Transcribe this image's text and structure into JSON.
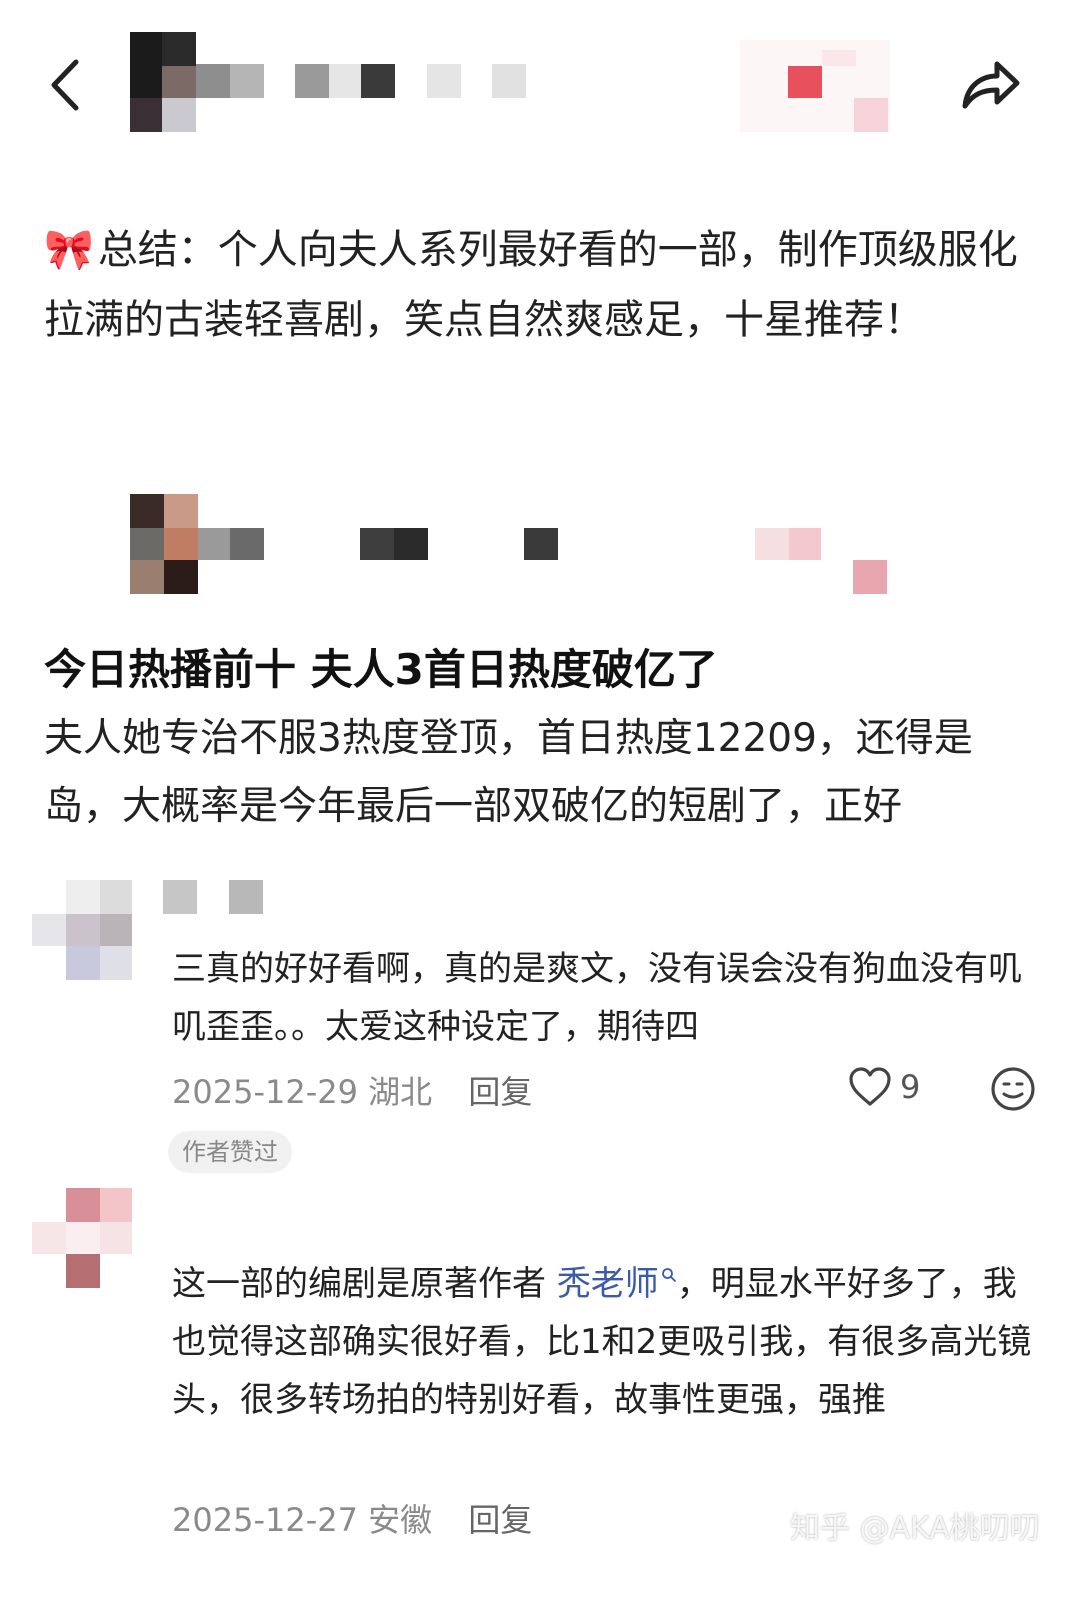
{
  "post": {
    "summary_emoji": "🎀",
    "summary_text": "总结：个人向夫人系列最好看的一部，制作顶级服化拉满的古装轻喜剧，笑点自然爽感足，十星推荐！"
  },
  "quoted_post": {
    "headline": "今日热播前十 夫人3首日热度破亿了",
    "body": "夫人她专治不服3热度登顶，首日热度12209，还得是岛，大概率是今年最后一部双破亿的短剧了，正好"
  },
  "comments": [
    {
      "text": "三真的好好看啊，真的是爽文，没有误会没有狗血没有叽叽歪歪。。太爱这种设定了，期待四",
      "date": "2025-12-29",
      "location": "湖北",
      "reply_label": "回复",
      "likes": "9",
      "badge": "作者赞过"
    },
    {
      "text_before": "这一部的编剧是原著作者 ",
      "mention": "秃老师",
      "text_after": "，明显水平好多了，我也觉得这部确实很好看，比1和2更吸引我，有很多高光镜头，很多转场拍的特别好看，故事性更强，强推",
      "date": "2025-12-27",
      "location": "安徽",
      "reply_label": "回复"
    }
  ],
  "watermark": "知乎 @AKA桃叨叨",
  "icons": {
    "back": "back-arrow-icon",
    "share": "share-icon",
    "like": "heart-icon",
    "reaction": "smile-face-icon",
    "mention_search": "search-icon"
  }
}
